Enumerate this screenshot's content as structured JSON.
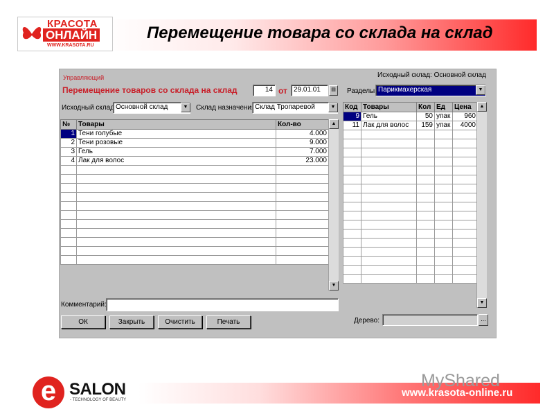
{
  "header": {
    "title": "Перемещение товара со склада на склад",
    "logo_top": "КРАСОТА",
    "logo_main": "ОНЛАЙН",
    "logo_url": "WWW.KRASOTA.RU"
  },
  "window": {
    "role": "Управляющий",
    "heading": "Перемещение товаров со склада на склад",
    "doc_number": "14",
    "from_label": "от",
    "doc_date": "29.01.01",
    "src_label": "Исходный склад:",
    "src_value": "Основной склад",
    "dst_label": "Склад назначения:",
    "dst_value": "Склад Тропаревой",
    "right_src_info": "Исходный склад: Основной склад",
    "sections_label": "Разделы:",
    "sections_value": "Парикмахерская",
    "left_table": {
      "headers": [
        "№",
        "Товары",
        "Кол-во"
      ],
      "rows": [
        {
          "n": "1",
          "name": "Тени голубые",
          "qty": "4.000"
        },
        {
          "n": "2",
          "name": "Тени розовые",
          "qty": "9.000"
        },
        {
          "n": "3",
          "name": "Гель",
          "qty": "7.000"
        },
        {
          "n": "4",
          "name": "Лак для волос",
          "qty": "23.000"
        }
      ]
    },
    "right_table": {
      "headers": [
        "Код",
        "Товары",
        "Кол",
        "Ед",
        "Цена"
      ],
      "rows": [
        {
          "code": "9",
          "name": "Гель",
          "qty": "50",
          "unit": "упак",
          "price": "960"
        },
        {
          "code": "11",
          "name": "Лак для волос",
          "qty": "159",
          "unit": "упак",
          "price": "4000"
        }
      ]
    },
    "comment_label": "Комментарий:",
    "tree_label": "Дерево:",
    "tree_btn": "...",
    "buttons": {
      "ok": "ОК",
      "close": "Закрыть",
      "clear": "Очистить",
      "print": "Печать"
    }
  },
  "footer": {
    "url": "www.krasota-online.ru",
    "salon_letter": "e",
    "salon_name": "SALON",
    "salon_slogan": "- TECHNOLOGY OF BEAUTY",
    "watermark": "MyShared"
  },
  "icons": {
    "dropdown": "▼",
    "scroll_up": "▲",
    "scroll_down": "▼",
    "calendar": "▤"
  }
}
